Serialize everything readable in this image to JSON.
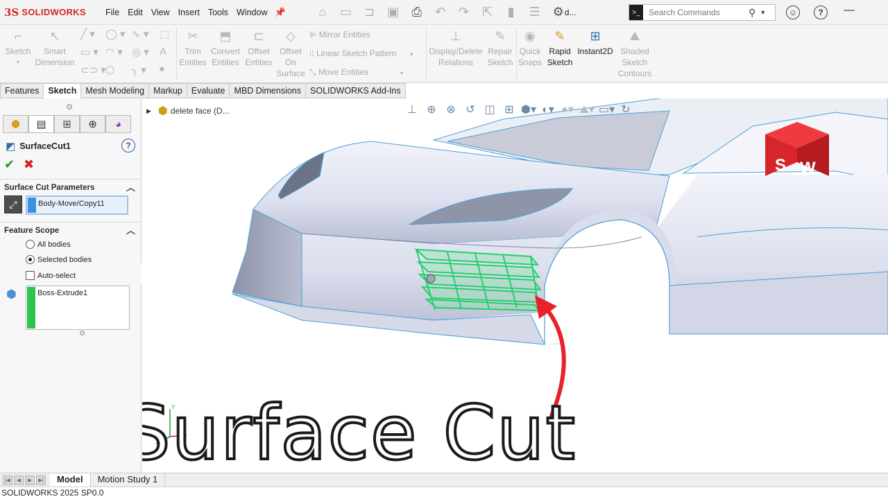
{
  "app": {
    "brand_prefix": "3S",
    "brand": "SOLIDWORKS",
    "doc_short": "d..."
  },
  "menu": [
    "File",
    "Edit",
    "View",
    "Insert",
    "Tools",
    "Window"
  ],
  "search": {
    "placeholder": "Search Commands"
  },
  "ribbon": {
    "sketch": "Sketch",
    "smart_dim": [
      "Smart",
      "Dimension"
    ],
    "trim": [
      "Trim",
      "Entities"
    ],
    "convert": [
      "Convert",
      "Entities"
    ],
    "offset": [
      "Offset",
      "Entities"
    ],
    "offset_surface": [
      "Offset",
      "On",
      "Surface"
    ],
    "mirror": "Mirror Entities",
    "linear_pattern": "Linear Sketch Pattern",
    "move": "Move Entities",
    "display_delete": [
      "Display/Delete",
      "Relations"
    ],
    "repair": [
      "Repair",
      "Sketch"
    ],
    "quick_snaps": [
      "Quick",
      "Snaps"
    ],
    "rapid": [
      "Rapid",
      "Sketch"
    ],
    "instant2d": "Instant2D",
    "shaded": [
      "Shaded",
      "Sketch",
      "Contours"
    ]
  },
  "tabs": [
    {
      "label": "Features",
      "selected": false
    },
    {
      "label": "Sketch",
      "selected": true
    },
    {
      "label": "Mesh Modeling",
      "selected": false
    },
    {
      "label": "Markup",
      "selected": false
    },
    {
      "label": "Evaluate",
      "selected": false
    },
    {
      "label": "MBD Dimensions",
      "selected": false
    },
    {
      "label": "SOLIDWORKS Add-Ins",
      "selected": false
    }
  ],
  "panel": {
    "feature_name": "SurfaceCut1",
    "section1": "Surface Cut Parameters",
    "cut_body": "Body-Move/Copy11",
    "section2": "Feature Scope",
    "scope_options": [
      {
        "label": "All bodies",
        "checked": false
      },
      {
        "label": "Selected bodies",
        "checked": true
      }
    ],
    "auto_select": "Auto-select",
    "selected_body": "Boss-Extrude1",
    "colors": {
      "cut_bar": "#3d8fe0",
      "body_bar": "#2ec24f"
    }
  },
  "viewport": {
    "tree_item": "delete face (D...",
    "overlay_title": "Surface Cut",
    "logo_letters": [
      "S",
      "W"
    ],
    "axis_y": "Y",
    "colors": {
      "car_body": "#e2e5f1",
      "edges": "#4a9fd8",
      "cut_mesh": "#21d16a",
      "arrow": "#e8222a",
      "cube": "#d7262b"
    }
  },
  "bottom": {
    "tabs": [
      {
        "label": "Model",
        "selected": true
      },
      {
        "label": "Motion Study 1",
        "selected": false
      }
    ]
  },
  "status": "SOLIDWORKS 2025 SP0.0"
}
